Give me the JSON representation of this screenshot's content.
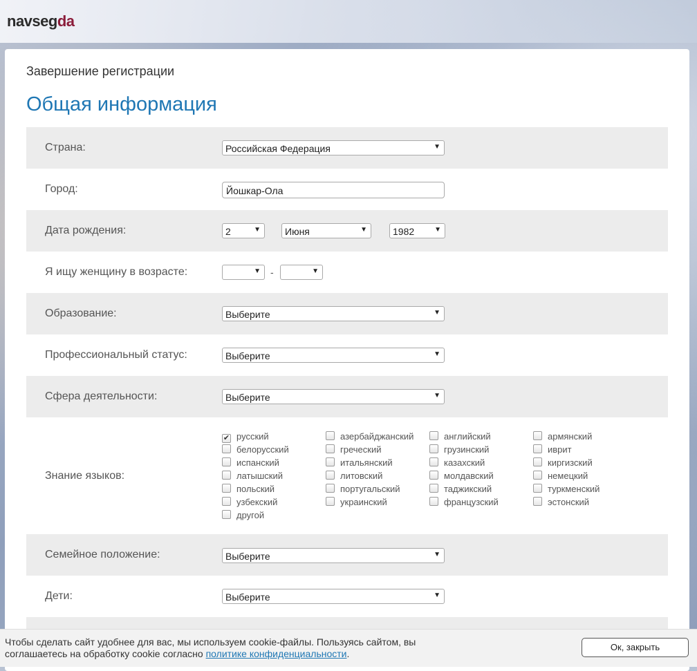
{
  "logo": {
    "part1": "navseg",
    "part2": "da"
  },
  "page": {
    "subtitle": "Завершение регистрации",
    "heading": "Общая информация"
  },
  "form": {
    "country": {
      "label": "Страна:",
      "value": "Российская Федерация"
    },
    "city": {
      "label": "Город:",
      "value": "Йошкар-Ола"
    },
    "birthdate": {
      "label": "Дата рождения:",
      "day": "2",
      "month": "Июня",
      "year": "1982"
    },
    "age_range": {
      "label": "Я ищу женщину в возрасте:",
      "from": "",
      "to": "",
      "separator": "-"
    },
    "education": {
      "label": "Образование:",
      "value": "Выберите"
    },
    "prof_status": {
      "label": "Профессиональный статус:",
      "value": "Выберите"
    },
    "sphere": {
      "label": "Сфера деятельности:",
      "value": "Выберите"
    },
    "languages": {
      "label": "Знание языков:",
      "items": [
        {
          "name": "русский",
          "checked": true
        },
        {
          "name": "белорусский",
          "checked": false
        },
        {
          "name": "испанский",
          "checked": false
        },
        {
          "name": "латышский",
          "checked": false
        },
        {
          "name": "польский",
          "checked": false
        },
        {
          "name": "узбекский",
          "checked": false
        },
        {
          "name": "другой",
          "checked": false
        },
        {
          "name": "азербайджанский",
          "checked": false
        },
        {
          "name": "греческий",
          "checked": false
        },
        {
          "name": "итальянский",
          "checked": false
        },
        {
          "name": "литовский",
          "checked": false
        },
        {
          "name": "португальский",
          "checked": false
        },
        {
          "name": "украинский",
          "checked": false
        },
        {
          "name": "английский",
          "checked": false
        },
        {
          "name": "грузинский",
          "checked": false
        },
        {
          "name": "казахский",
          "checked": false
        },
        {
          "name": "молдавский",
          "checked": false
        },
        {
          "name": "таджикский",
          "checked": false
        },
        {
          "name": "французский",
          "checked": false
        },
        {
          "name": "армянский",
          "checked": false
        },
        {
          "name": "иврит",
          "checked": false
        },
        {
          "name": "киргизский",
          "checked": false
        },
        {
          "name": "немецкий",
          "checked": false
        },
        {
          "name": "туркменский",
          "checked": false
        },
        {
          "name": "эстонский",
          "checked": false
        }
      ]
    },
    "marital": {
      "label": "Семейное положение:",
      "value": "Выберите"
    },
    "children": {
      "label": "Дети:",
      "value": "Выберите"
    }
  },
  "cookie": {
    "text": "Чтобы сделать сайт удобнее для вас, мы используем cookie-файлы. Пользуясь сайтом, вы соглашаетесь на обработку cookie согласно ",
    "link": "политике конфиденциальности",
    "tail": ".",
    "button": "Ок, закрыть"
  },
  "icons": {
    "dropdown": "chevron-down-icon",
    "check": "checkmark-icon"
  },
  "colors": {
    "heading": "#1f77b4",
    "logo_accent": "#8b1c3a",
    "row_shade": "#ececec"
  }
}
